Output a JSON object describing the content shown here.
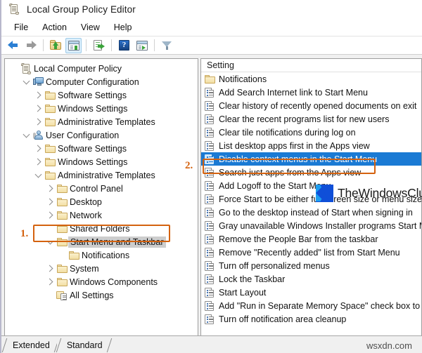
{
  "window": {
    "title": "Local Group Policy Editor",
    "icon": "policy-document-icon"
  },
  "menu": {
    "items": [
      "File",
      "Action",
      "View",
      "Help"
    ]
  },
  "toolbar": {
    "buttons": [
      {
        "name": "back-button",
        "icon": "back-arrow-icon"
      },
      {
        "name": "forward-button",
        "icon": "forward-arrow-icon"
      },
      {
        "name": "up-one-level-button",
        "icon": "folder-up-icon"
      },
      {
        "name": "show-hide-console-tree-button",
        "icon": "console-tree-icon"
      },
      {
        "name": "export-list-button",
        "icon": "export-list-icon"
      },
      {
        "name": "help-button",
        "icon": "help-question-icon"
      },
      {
        "name": "show-hide-action-pane-button",
        "icon": "action-pane-icon"
      },
      {
        "name": "filter-button",
        "icon": "funnel-filter-icon"
      }
    ]
  },
  "tree": {
    "root": "Local Computer Policy",
    "nodes": [
      {
        "label": "Local Computer Policy",
        "indent": 0,
        "twist": "none",
        "icon": "policy-document-icon"
      },
      {
        "label": "Computer Configuration",
        "indent": 1,
        "twist": "down",
        "icon": "computer-icon"
      },
      {
        "label": "Software Settings",
        "indent": 2,
        "twist": "right",
        "icon": "folder-icon"
      },
      {
        "label": "Windows Settings",
        "indent": 2,
        "twist": "right",
        "icon": "folder-icon"
      },
      {
        "label": "Administrative Templates",
        "indent": 2,
        "twist": "right",
        "icon": "folder-icon"
      },
      {
        "label": "User Configuration",
        "indent": 1,
        "twist": "down",
        "icon": "user-icon"
      },
      {
        "label": "Software Settings",
        "indent": 2,
        "twist": "right",
        "icon": "folder-icon"
      },
      {
        "label": "Windows Settings",
        "indent": 2,
        "twist": "right",
        "icon": "folder-icon"
      },
      {
        "label": "Administrative Templates",
        "indent": 2,
        "twist": "down",
        "icon": "folder-icon"
      },
      {
        "label": "Control Panel",
        "indent": 3,
        "twist": "right",
        "icon": "folder-icon"
      },
      {
        "label": "Desktop",
        "indent": 3,
        "twist": "right",
        "icon": "folder-icon"
      },
      {
        "label": "Network",
        "indent": 3,
        "twist": "right",
        "icon": "folder-icon"
      },
      {
        "label": "Shared Folders",
        "indent": 3,
        "twist": "none",
        "icon": "folder-icon"
      },
      {
        "label": "Start Menu and Taskbar",
        "indent": 3,
        "twist": "down",
        "icon": "folder-icon",
        "selected": true
      },
      {
        "label": "Notifications",
        "indent": 4,
        "twist": "none",
        "icon": "folder-icon"
      },
      {
        "label": "System",
        "indent": 3,
        "twist": "right",
        "icon": "folder-icon"
      },
      {
        "label": "Windows Components",
        "indent": 3,
        "twist": "right",
        "icon": "folder-icon"
      },
      {
        "label": "All Settings",
        "indent": 3,
        "twist": "none",
        "icon": "all-settings-icon"
      }
    ]
  },
  "list": {
    "column_header": "Setting",
    "rows": [
      {
        "label": "Notifications",
        "icon": "folder-icon"
      },
      {
        "label": "Add Search Internet link to Start Menu",
        "icon": "policy-setting-icon"
      },
      {
        "label": "Clear history of recently opened documents on exit",
        "icon": "policy-setting-icon"
      },
      {
        "label": "Clear the recent programs list for new users",
        "icon": "policy-setting-icon"
      },
      {
        "label": "Clear tile notifications during log on",
        "icon": "policy-setting-icon"
      },
      {
        "label": "List desktop apps first in the Apps view",
        "icon": "policy-setting-icon"
      },
      {
        "label": "Disable context menus in the Start Menu",
        "icon": "policy-setting-icon",
        "selected": true
      },
      {
        "label": "Search just apps from the Apps view",
        "icon": "policy-setting-icon"
      },
      {
        "label": "Add Logoff to the Start Menu",
        "icon": "policy-setting-icon"
      },
      {
        "label": "Force Start to be either full screen size or menu size",
        "icon": "policy-setting-icon"
      },
      {
        "label": "Go to the desktop instead of Start when signing in",
        "icon": "policy-setting-icon"
      },
      {
        "label": "Gray unavailable Windows Installer programs Start Menu",
        "icon": "policy-setting-icon"
      },
      {
        "label": "Remove the People Bar from the taskbar",
        "icon": "policy-setting-icon"
      },
      {
        "label": "Remove \"Recently added\" list from Start Menu",
        "icon": "policy-setting-icon"
      },
      {
        "label": "Turn off personalized menus",
        "icon": "policy-setting-icon"
      },
      {
        "label": "Lock the Taskbar",
        "icon": "policy-setting-icon"
      },
      {
        "label": "Start Layout",
        "icon": "policy-setting-icon"
      },
      {
        "label": "Add \"Run in Separate Memory Space\" check box to Run",
        "icon": "policy-setting-icon"
      },
      {
        "label": "Turn off notification area cleanup",
        "icon": "policy-setting-icon"
      }
    ]
  },
  "tabs": {
    "items": [
      "Extended",
      "Standard"
    ],
    "active": "Standard"
  },
  "annotations": {
    "step1": "1.",
    "step2": "2.",
    "color": "#d4620f"
  },
  "watermarks": {
    "brand": "TheWindowsClub",
    "source": "wsxdn.com"
  }
}
